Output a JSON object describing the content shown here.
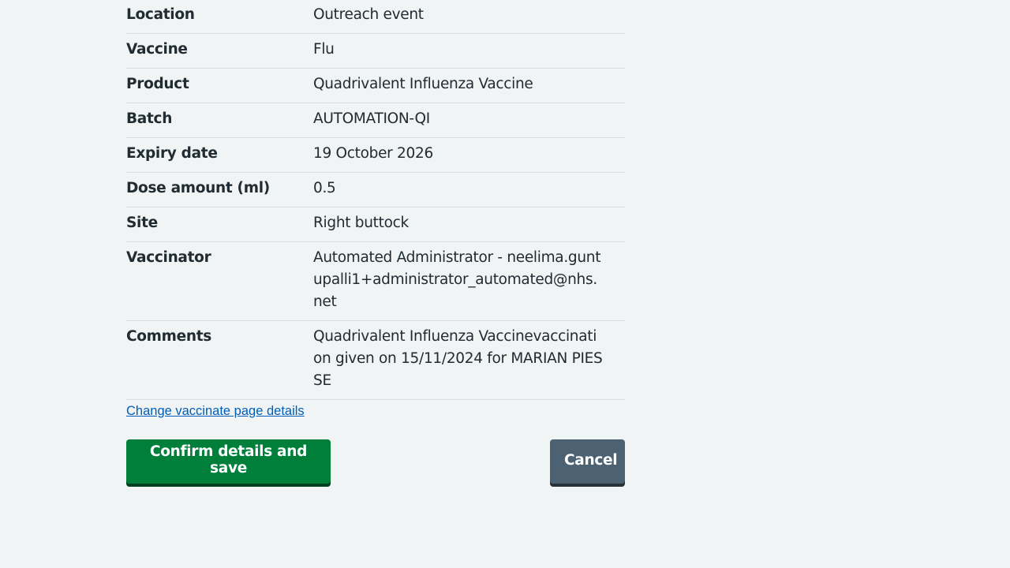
{
  "summary": [
    {
      "key": "Location",
      "value": "Outreach event"
    },
    {
      "key": "Vaccine",
      "value": "Flu"
    },
    {
      "key": "Product",
      "value": "Quadrivalent Influenza Vaccine"
    },
    {
      "key": "Batch",
      "value": "AUTOMATION-QI"
    },
    {
      "key": "Expiry date",
      "value": "19 October 2026"
    },
    {
      "key": "Dose amount (ml)",
      "value": "0.5"
    },
    {
      "key": "Site",
      "value": "Right buttock"
    },
    {
      "key": "Vaccinator",
      "value": "Automated Administrator - neelima.guntupalli1+administrator_automated@nhs.net"
    },
    {
      "key": "Comments",
      "value": "Quadrivalent Influenza Vaccinevaccination given on 15/11/2024 for MARIAN PIESSE"
    }
  ],
  "change_link": "Change vaccinate page details",
  "actions": {
    "confirm_label": "Confirm details and save",
    "cancel_label": "Cancel"
  },
  "colors": {
    "background": "#f0f4f5",
    "confirm": "#007f3b",
    "cancel": "#4c6272",
    "link": "#005eb8"
  }
}
